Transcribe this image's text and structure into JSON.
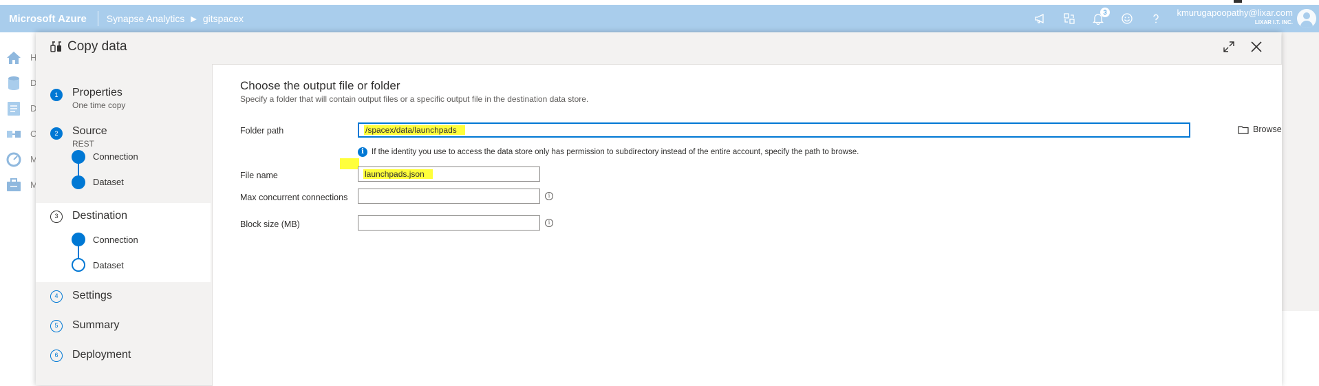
{
  "header": {
    "brand": "Microsoft Azure",
    "breadcrumb": [
      "Synapse Analytics",
      "gitspacex"
    ],
    "notification_count": "3",
    "user_email": "kmurugapoopathy@lixar.com",
    "user_org": "LIXAR I.T. INC.",
    "icons": [
      "megaphone-icon",
      "directory-switch-icon",
      "bell-icon",
      "smiley-icon",
      "help-icon"
    ]
  },
  "leftnav": {
    "letters": [
      "H",
      "D",
      "D",
      "C",
      "M",
      "M"
    ]
  },
  "dialog": {
    "title": "Copy data",
    "steps": [
      {
        "num": "1",
        "label": "Properties",
        "sub": "One time copy"
      },
      {
        "num": "2",
        "label": "Source",
        "sub": "REST",
        "children": [
          "Connection",
          "Dataset"
        ]
      },
      {
        "num": "3",
        "label": "Destination",
        "children": [
          "Connection",
          "Dataset"
        ]
      },
      {
        "num": "4",
        "label": "Settings"
      },
      {
        "num": "5",
        "label": "Summary"
      },
      {
        "num": "6",
        "label": "Deployment"
      }
    ]
  },
  "panel": {
    "title": "Choose the output file or folder",
    "description": "Specify a folder that will contain output files or a specific output file in the destination data store.",
    "folder_path_label": "Folder path",
    "folder_path_value": "/spacex/data/launchpads",
    "browse_label": "Browse",
    "info_note": "If the identity you use to access the data store only has permission to subdirectory instead of the entire account, specify the path to browse.",
    "file_name_label": "File name",
    "file_name_value": "launchpads.json",
    "max_conn_label": "Max concurrent connections",
    "max_conn_value": "",
    "block_size_label": "Block size (MB)",
    "block_size_value": ""
  },
  "colors": {
    "header_bg": "#a9cdec",
    "accent": "#0078d4",
    "highlight": "#ffff3b"
  }
}
